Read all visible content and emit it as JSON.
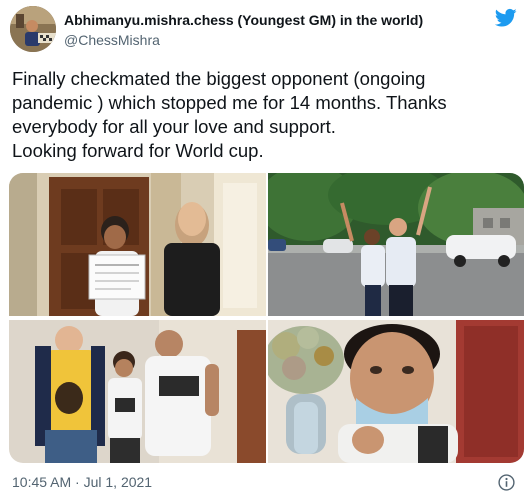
{
  "author": {
    "display_name": "Abhimanyu.mishra.chess (Youngest GM) in the world)",
    "handle": "@ChessMishra"
  },
  "tweet": {
    "lines": [
      "Finally checkmated the biggest opponent (ongoing",
      "pandemic ) which stopped me for 14 months. Thanks",
      "everybody for all your love and support.",
      "Looking forward for World cup."
    ]
  },
  "photos": {
    "count": 4
  },
  "meta": {
    "timestamp": "10:45 AM · Jul 1, 2021"
  },
  "icons": {
    "brand": "twitter-bird-icon",
    "info": "info-circle-icon"
  },
  "colors": {
    "brand": "#1d9bf0",
    "text_primary": "#0f1419",
    "text_secondary": "#536471"
  }
}
